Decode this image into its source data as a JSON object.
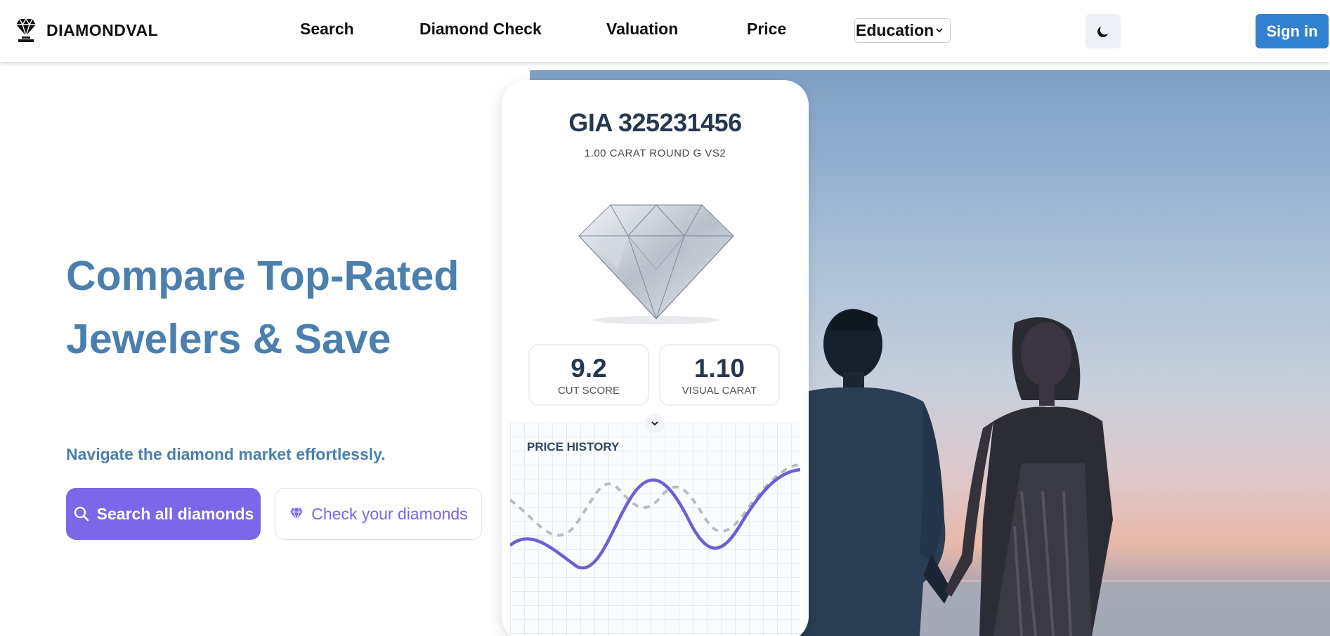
{
  "header": {
    "brand": "DIAMONDVAL",
    "nav": [
      "Search",
      "Diamond Check",
      "Valuation",
      "Price"
    ],
    "education_select": "Education",
    "sign_in": "Sign in"
  },
  "hero": {
    "title": "Compare Top-Rated Jewelers & Save",
    "subtitle": "Navigate the diamond market effortlessly.",
    "primary_button": "Search all diamonds",
    "secondary_button": "Check your diamonds"
  },
  "card": {
    "title": "GIA 325231456",
    "subtitle": "1.00 CARAT ROUND G VS2",
    "stats": [
      {
        "value": "9.2",
        "label": "CUT SCORE"
      },
      {
        "value": "1.10",
        "label": "VISUAL CARAT"
      }
    ],
    "price_history_label": "PRICE HISTORY"
  },
  "colors": {
    "accent_purple": "#7b67e8",
    "brand_blue": "#3182ce",
    "hero_text": "#4a7fae"
  },
  "icons": [
    "diamond-logo-icon",
    "chevron-down-icon",
    "moon-icon",
    "search-icon",
    "diamond-icon"
  ]
}
